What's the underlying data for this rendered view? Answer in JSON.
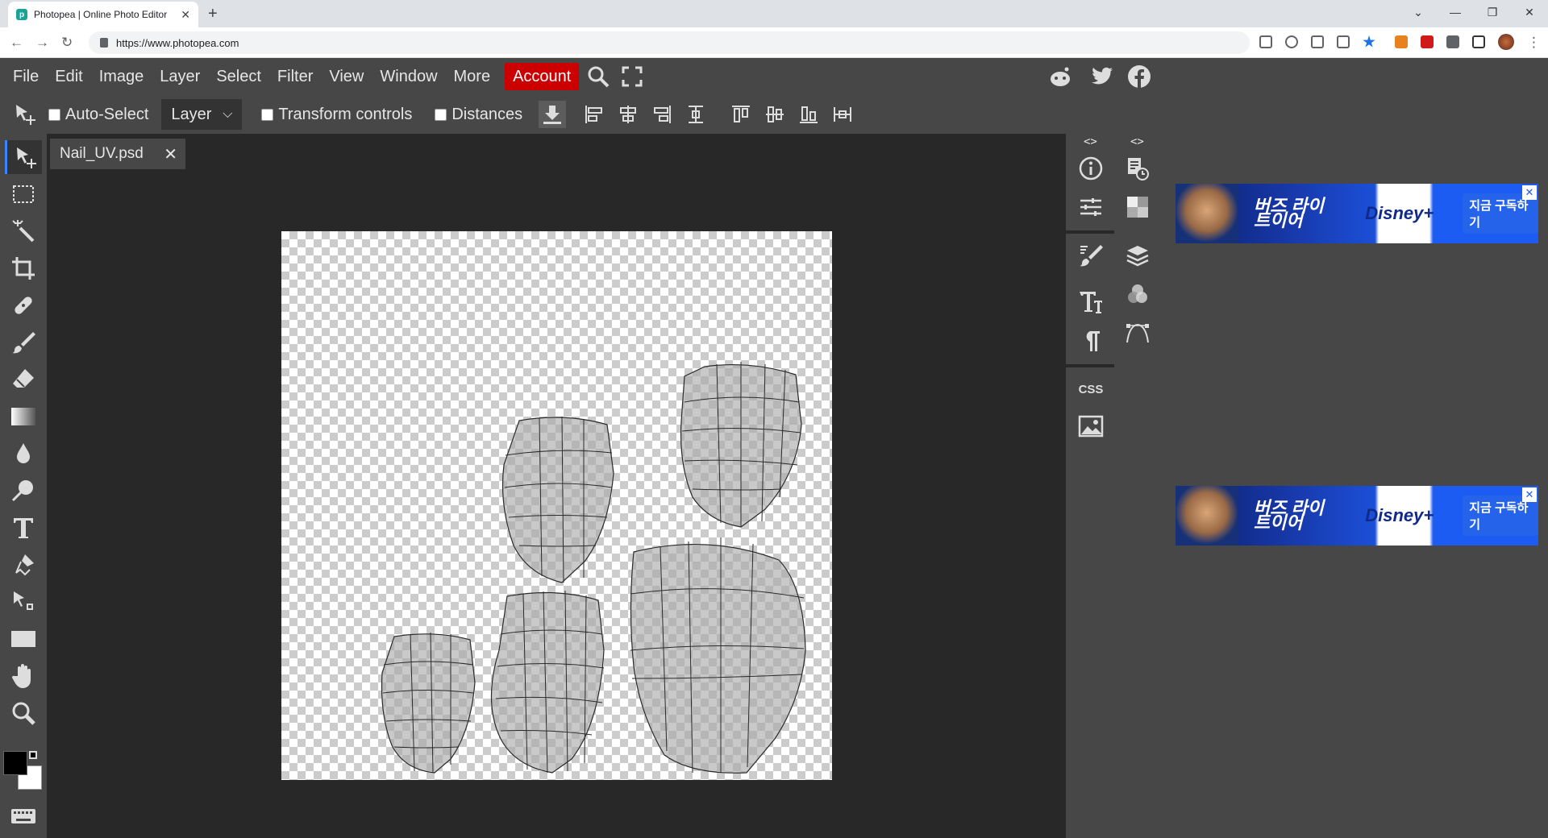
{
  "browser": {
    "tab_title": "Photopea | Online Photo Editor",
    "favicon_text": "p",
    "url": "https://www.photopea.com"
  },
  "menu": {
    "items": [
      "File",
      "Edit",
      "Image",
      "Layer",
      "Select",
      "Filter",
      "View",
      "Window",
      "More"
    ],
    "account_label": "Account"
  },
  "options": {
    "auto_select_label": "Auto-Select",
    "layer_dropdown": "Layer",
    "transform_label": "Transform controls",
    "distances_label": "Distances"
  },
  "document": {
    "tab_name": "Nail_UV.psd"
  },
  "panel": {
    "expand_left": "<>",
    "expand_right": "<>",
    "css_label": "CSS"
  },
  "ads": {
    "title": "버즈 라이트이어",
    "brand": "Disney+",
    "cta": "지금 구독하기"
  },
  "colors": {
    "accent": "#3a85ff",
    "account": "#cc0000",
    "foreground": "#000000",
    "background": "#ffffff"
  }
}
